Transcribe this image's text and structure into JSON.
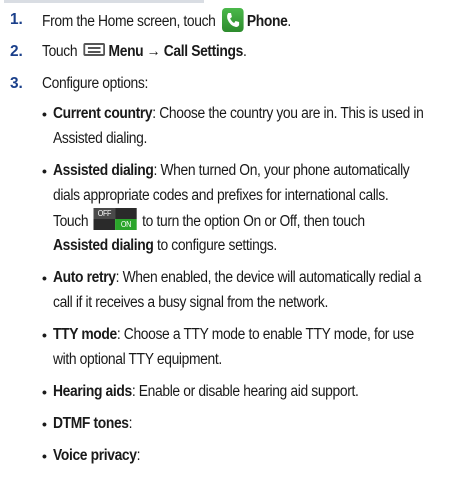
{
  "steps": [
    {
      "number": "1.",
      "pre": "From the Home screen, touch ",
      "bold": "Phone",
      "post": "."
    },
    {
      "number": "2.",
      "pre": "Touch ",
      "bold": "Menu → Call Settings",
      "post": "."
    },
    {
      "number": "3.",
      "text": "Configure options:"
    }
  ],
  "options": [
    {
      "term": "Current country",
      "lines": [
        ": Choose the country you are in. This is used in",
        "Assisted dialing."
      ]
    },
    {
      "term": "Assisted dialing",
      "lines": [
        ": When turned On, your phone automatically",
        "dials appropriate codes and prefixes for international calls."
      ]
    },
    {
      "term": "Auto retry",
      "lines": [
        ": When enabled, the device will automatically redial a",
        "call if it receives a busy signal from the network."
      ]
    },
    {
      "term": "TTY mode",
      "lines": [
        ": Choose a TTY mode to enable TTY mode, for use",
        "with optional TTY equipment."
      ]
    },
    {
      "term": "Hearing aids",
      "lines": [
        ": Enable or disable hearing aid support."
      ]
    },
    {
      "term": "DTMF tones",
      "lines": [
        ":"
      ]
    },
    {
      "term": "Voice privacy",
      "lines": [
        ":"
      ]
    }
  ],
  "assisted_extra": {
    "touch_pre": "Touch",
    "touch_post": "to turn the option On or Off, then touch",
    "bold_end": "Assisted dialing",
    "end_post": " to configure settings."
  },
  "toggle": {
    "off_label": "OFF",
    "on_label": "ON"
  },
  "icons": {
    "phone": "phone-app-icon",
    "menu": "menu-icon",
    "toggle": "on-off-toggle-icon"
  },
  "colors": {
    "step_number": "#1a3f8a",
    "phone_icon": "#3aa53a",
    "toggle_on": "#2aa52a"
  }
}
